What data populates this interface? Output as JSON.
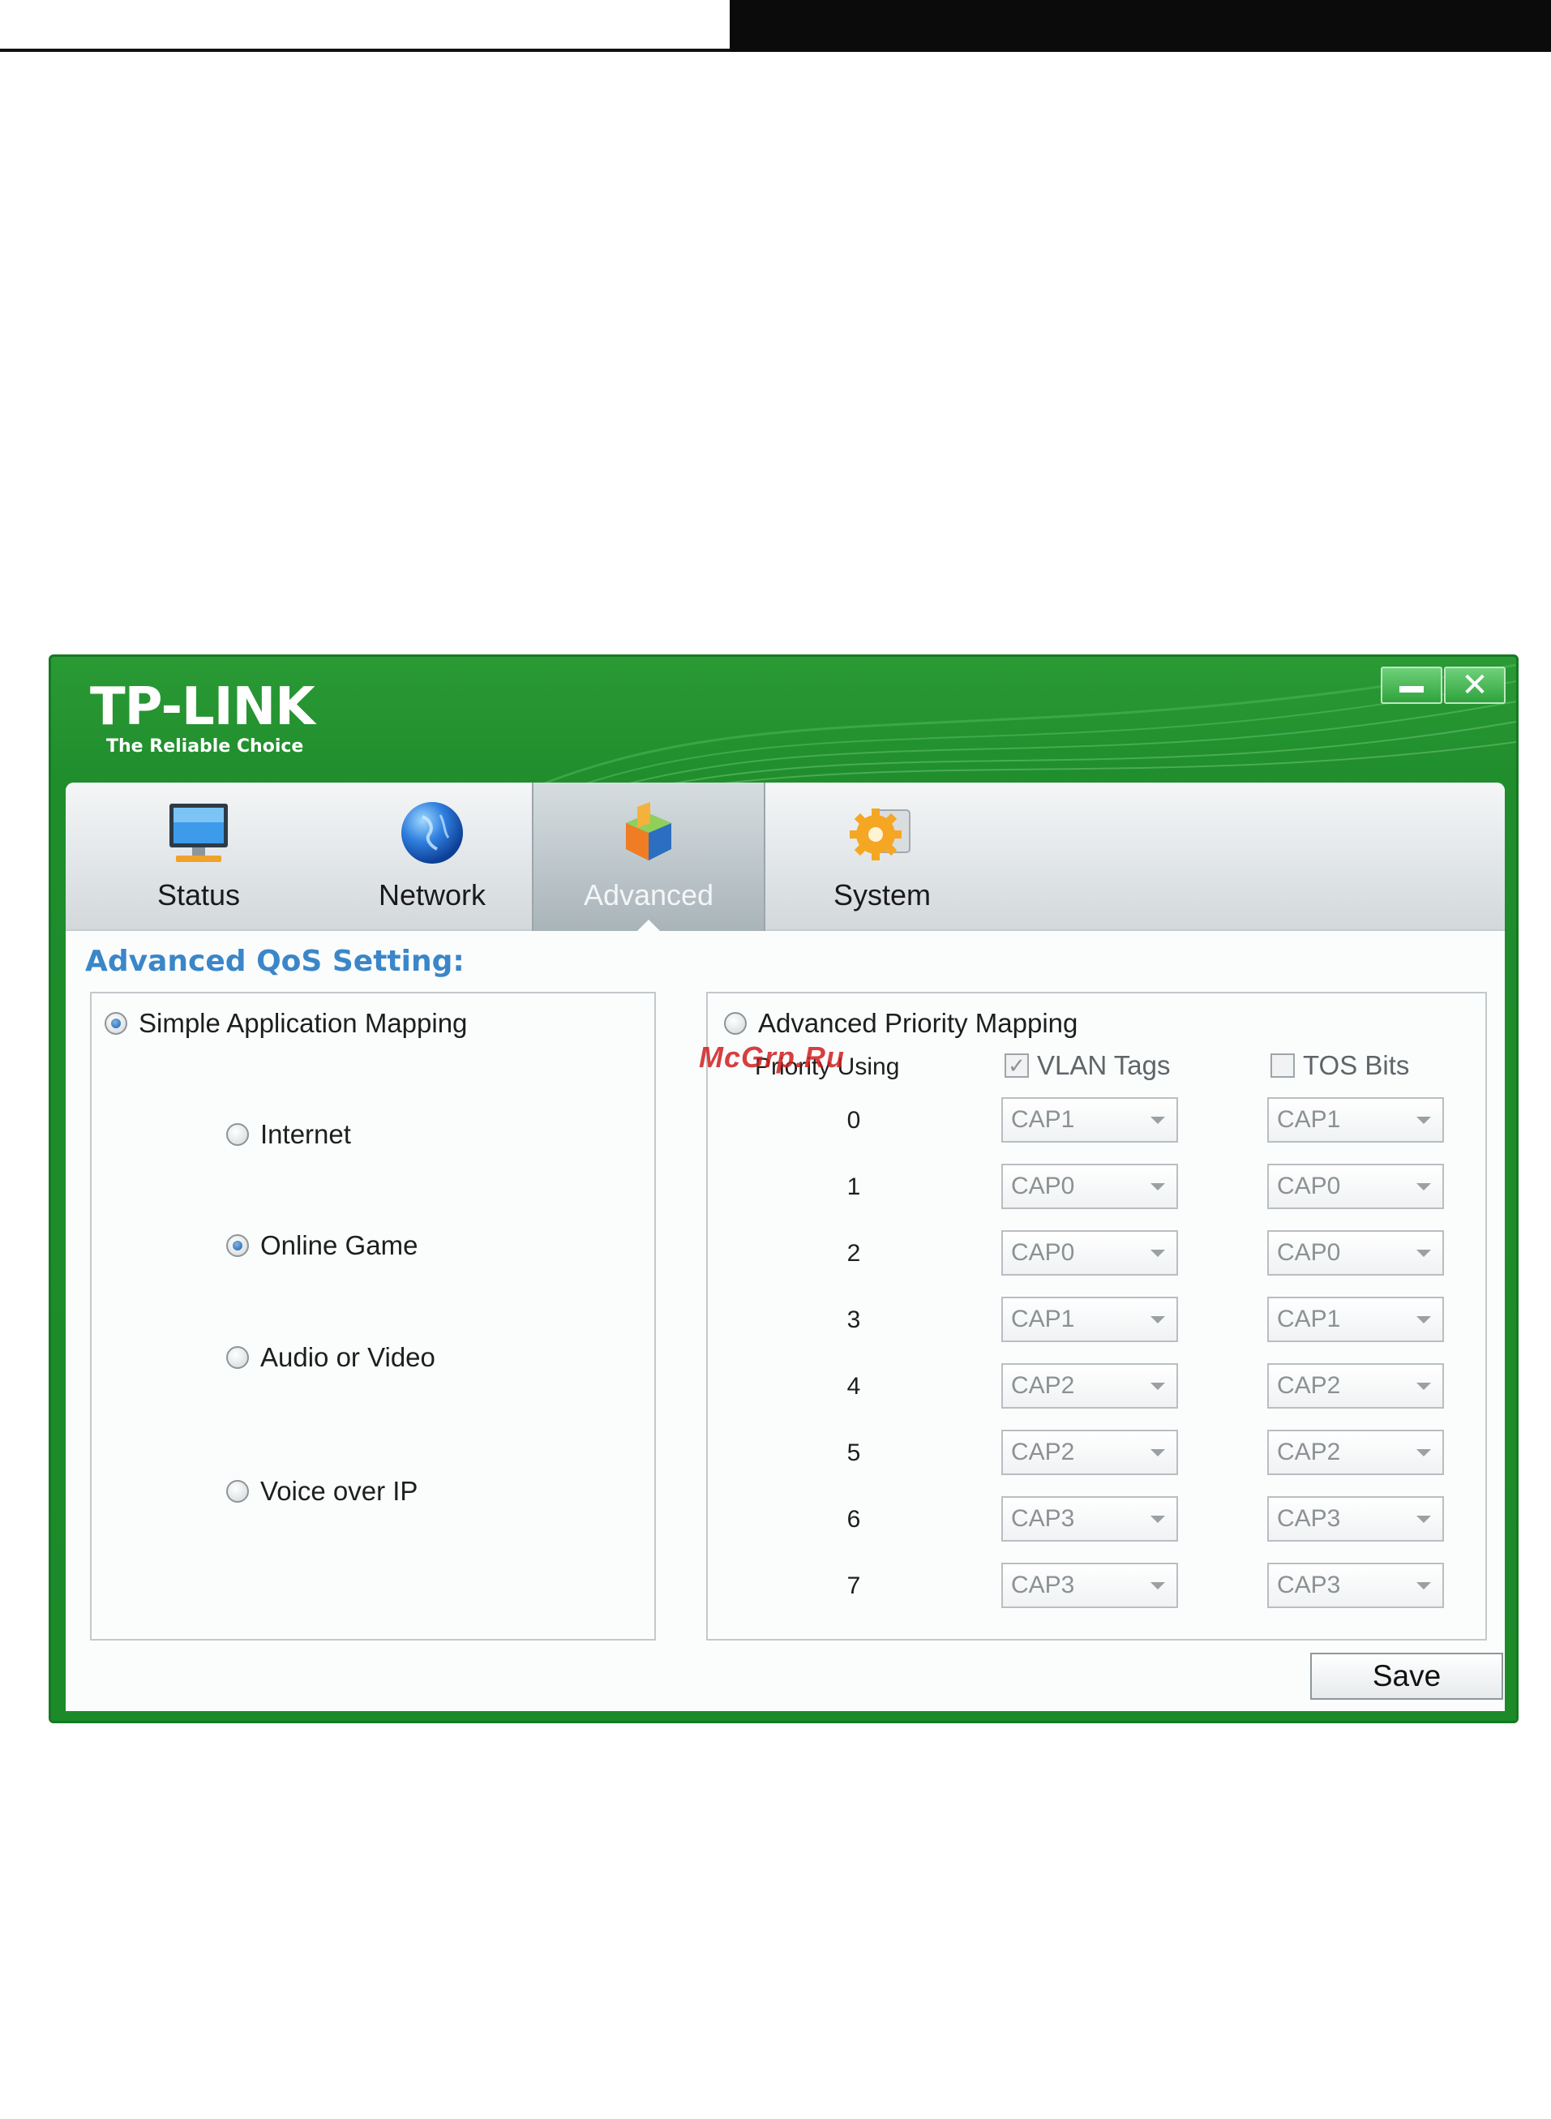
{
  "window": {
    "brand": "TP-LINK",
    "tagline": "The Reliable Choice",
    "minimize_icon": "minimize-icon",
    "close_label": "✕"
  },
  "tabs": [
    {
      "label": "Status",
      "icon": "monitor-icon"
    },
    {
      "label": "Network",
      "icon": "globe-icon"
    },
    {
      "label": "Advanced",
      "icon": "chart-cube-icon",
      "active": true
    },
    {
      "label": "System",
      "icon": "gear-icon"
    }
  ],
  "section_title": "Advanced QoS Setting:",
  "simple": {
    "label": "Simple Application Mapping",
    "selected": true,
    "options": [
      {
        "label": "Internet",
        "selected": false
      },
      {
        "label": "Online Game",
        "selected": true
      },
      {
        "label": "Audio or Video",
        "selected": false
      },
      {
        "label": "Voice over IP",
        "selected": false
      }
    ]
  },
  "advanced": {
    "label": "Advanced Priority Mapping",
    "selected": false,
    "priority_using_label": "Priority Using",
    "vlan_label": "VLAN Tags",
    "vlan_checked": true,
    "tos_label": "TOS Bits",
    "tos_checked": false,
    "rows": [
      {
        "priority": "0",
        "vlan": "CAP1",
        "tos": "CAP1"
      },
      {
        "priority": "1",
        "vlan": "CAP0",
        "tos": "CAP0"
      },
      {
        "priority": "2",
        "vlan": "CAP0",
        "tos": "CAP0"
      },
      {
        "priority": "3",
        "vlan": "CAP1",
        "tos": "CAP1"
      },
      {
        "priority": "4",
        "vlan": "CAP2",
        "tos": "CAP2"
      },
      {
        "priority": "5",
        "vlan": "CAP2",
        "tos": "CAP2"
      },
      {
        "priority": "6",
        "vlan": "CAP3",
        "tos": "CAP3"
      },
      {
        "priority": "7",
        "vlan": "CAP3",
        "tos": "CAP3"
      }
    ]
  },
  "save_label": "Save",
  "watermark": "McGrp.Ru",
  "colors": {
    "brand_green": "#1f8d2c",
    "title_blue": "#3b86c8"
  }
}
